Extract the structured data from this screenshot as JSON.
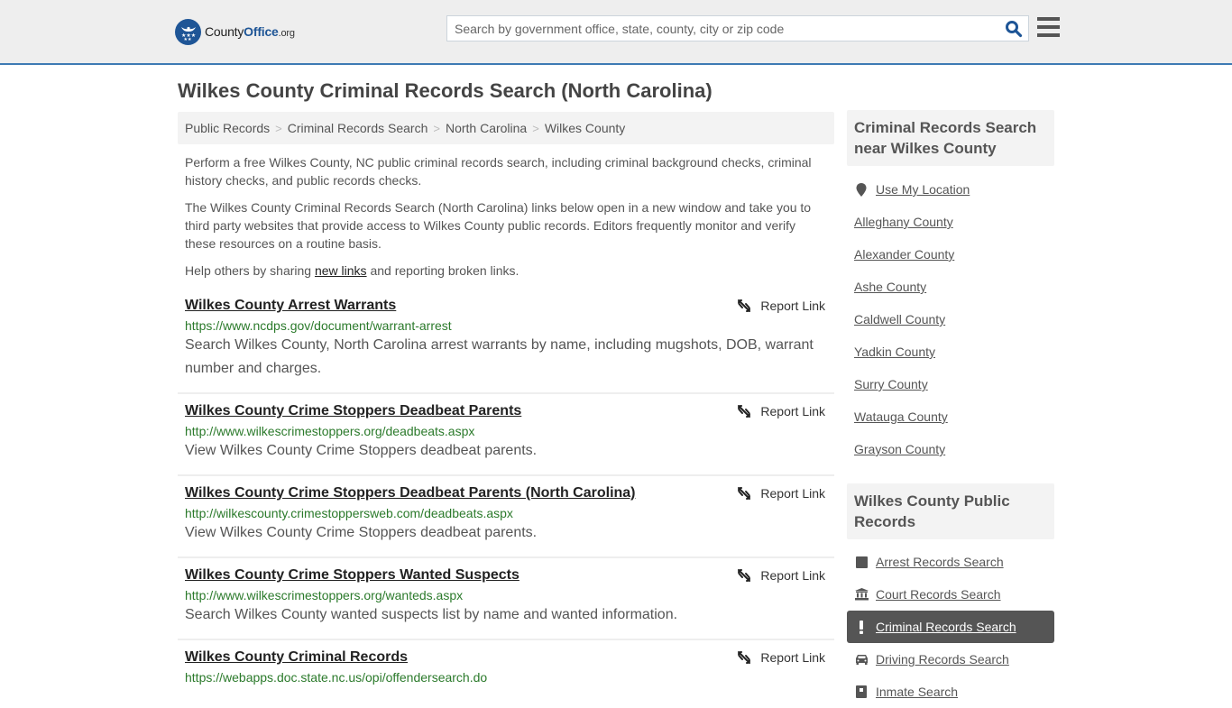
{
  "header": {
    "logo": {
      "brand_a": "County",
      "brand_b": "Office",
      "brand_c": ".org"
    },
    "search": {
      "placeholder": "Search by government office, state, county, city or zip code",
      "value": ""
    },
    "colors": {
      "brand_blue": "#1e5596",
      "header_border": "#3d7ab3",
      "header_bg": "#eeeeee"
    }
  },
  "page": {
    "title": "Wilkes County Criminal Records Search (North Carolina)"
  },
  "breadcrumb": [
    {
      "label": "Public Records"
    },
    {
      "label": "Criminal Records Search"
    },
    {
      "label": "North Carolina"
    },
    {
      "label": "Wilkes County"
    }
  ],
  "breadcrumb_separator": ">",
  "intro": {
    "p1": "Perform a free Wilkes County, NC public criminal records search, including criminal background checks, criminal history checks, and public records checks.",
    "p2": "The Wilkes County Criminal Records Search (North Carolina) links below open in a new window and take you to third party websites that provide access to Wilkes County public records. Editors frequently monitor and verify these resources on a routine basis.",
    "p3_before": "Help others by sharing ",
    "p3_link": "new links",
    "p3_after": " and reporting broken links."
  },
  "results": [
    {
      "title": "Wilkes County Arrest Warrants",
      "url": "https://www.ncdps.gov/document/warrant-arrest",
      "description": "Search Wilkes County, North Carolina arrest warrants by name, including mugshots, DOB, warrant number and charges.",
      "report_label": "Report Link"
    },
    {
      "title": "Wilkes County Crime Stoppers Deadbeat Parents",
      "url": "http://www.wilkescrimestoppers.org/deadbeats.aspx",
      "description": "View Wilkes County Crime Stoppers deadbeat parents.",
      "report_label": "Report Link"
    },
    {
      "title": "Wilkes County Crime Stoppers Deadbeat Parents (North Carolina)",
      "url": "http://wilkescounty.crimestoppersweb.com/deadbeats.aspx",
      "description": "View Wilkes County Crime Stoppers deadbeat parents.",
      "report_label": "Report Link"
    },
    {
      "title": "Wilkes County Crime Stoppers Wanted Suspects",
      "url": "http://www.wilkescrimestoppers.org/wanteds.aspx",
      "description": "Search Wilkes County wanted suspects list by name and wanted information.",
      "report_label": "Report Link"
    },
    {
      "title": "Wilkes County Criminal Records",
      "url": "https://webapps.doc.state.nc.us/opi/offendersearch.do",
      "description": "",
      "report_label": "Report Link"
    }
  ],
  "sidebar": {
    "nearby": {
      "heading": "Criminal Records Search near Wilkes County",
      "use_location": {
        "label": "Use My Location",
        "icon": "map-pin-icon"
      },
      "counties": [
        "Alleghany County",
        "Alexander County",
        "Ashe County",
        "Caldwell County",
        "Yadkin County",
        "Surry County",
        "Watauga County",
        "Grayson County"
      ]
    },
    "public_records": {
      "heading": "Wilkes County Public Records",
      "items": [
        {
          "label": "Arrest Records Search",
          "icon": "square-icon",
          "active": false
        },
        {
          "label": "Court Records Search",
          "icon": "courthouse-icon",
          "active": false
        },
        {
          "label": "Criminal Records Search",
          "icon": "exclamation-icon",
          "active": true
        },
        {
          "label": "Driving Records Search",
          "icon": "car-icon",
          "active": false
        },
        {
          "label": "Inmate Search",
          "icon": "inmate-icon",
          "active": false
        }
      ]
    }
  }
}
